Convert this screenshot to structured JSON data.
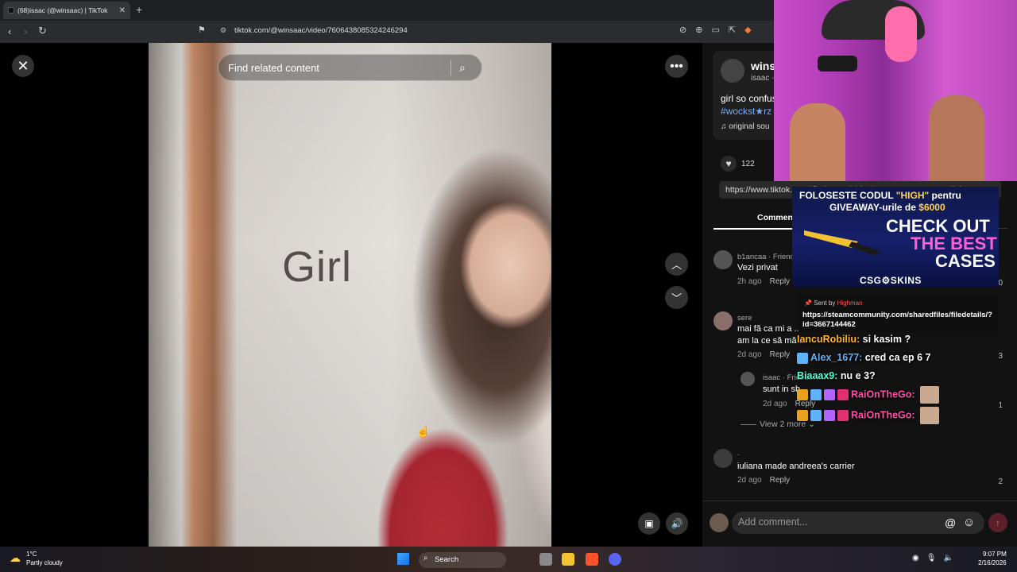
{
  "browser": {
    "tab_title": "(68)isaac (@winsaac) | TikTok",
    "tab_close": "✕",
    "new_tab": "+",
    "url": "tiktok.com/@winsaac/video/7606438085324246294"
  },
  "video": {
    "overlay_text": "Girl",
    "search_placeholder": "Find related content"
  },
  "post": {
    "author_name": "wins",
    "author_handle": "isaac ·",
    "description": "girl so confus",
    "hashtag": "#wockst★rz",
    "sound": "♫  original sou",
    "like_count": "122",
    "link": "https://www.tiktok.com/@winsaac/video/7606438085...   Copy link",
    "comments_tab": "Comments"
  },
  "comments": [
    {
      "name": "b1ancaa · Friends",
      "text": "Vezi privat",
      "time": "2h ago",
      "reply": "Reply",
      "likes": "0"
    },
    {
      "name": "sere",
      "text": "mai fă ca mi a ..",
      "text2": "am la ce să mă ..",
      "time": "2d ago",
      "reply": "Reply",
      "likes": "3"
    },
    {
      "name": "isaac · Friends",
      "text": "sunt in sh..",
      "time": "2d ago",
      "reply": "Reply",
      "likes": "1"
    },
    {
      "name": ".",
      "text": "iuliana made andreea's carrier",
      "time": "2d ago",
      "reply": "Reply",
      "likes": "2"
    }
  ],
  "view_more": "View 2 more",
  "add_comment_placeholder": "Add comment...",
  "stream": {
    "ad_line1_prefix": "FOLOSESTE CODUL ",
    "ad_code": "\"HIGH\"",
    "ad_line1_suffix": " pentru",
    "ad_line2_prefix": "GIVEAWAY-urile de ",
    "ad_amount": "$6000",
    "ad_big1": "CHECK OUT",
    "ad_big2": "THE BEST",
    "ad_big3": "CASES",
    "ad_brand": "CSG⚙SKINS",
    "sent_by_label": "Sent by ",
    "sent_by_user": "Highman",
    "sent_url": "https://steamcommunity.com/sharedfiles/filedetails/?id=3667144462",
    "chat": [
      {
        "user": "IancuRobiliu:",
        "msg": " si kasim ?"
      },
      {
        "user": "Alex_1677:",
        "msg": " cred ca ep 6 7"
      },
      {
        "user": "Biaaax9:",
        "msg": " nu e 3?"
      },
      {
        "user": "RaiOnTheGo:",
        "msg": ""
      },
      {
        "user": "RaiOnTheGo:",
        "msg": ""
      }
    ]
  },
  "taskbar": {
    "temp": "1°C",
    "weather": "Partly cloudy",
    "search": "Search",
    "time": "9:07 PM",
    "date": "2/16/2026"
  },
  "colors": {
    "accent_link": "#7aa8ff",
    "tiktok_send": "#5a1f28",
    "ad_yellow": "#ffd24a",
    "ad_pink": "#ff5fd2"
  }
}
